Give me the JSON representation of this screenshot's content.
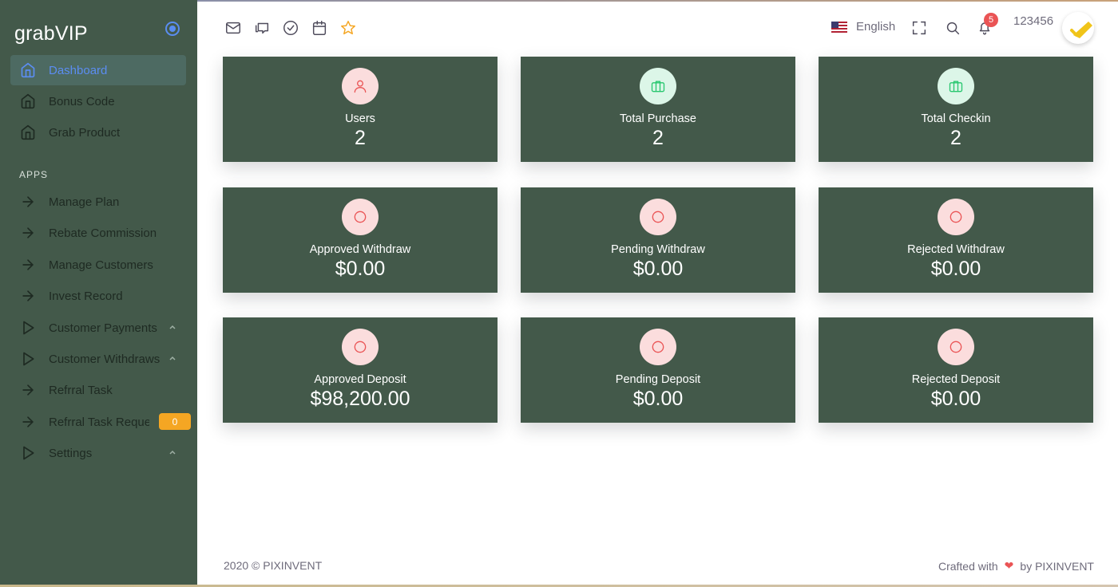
{
  "app": {
    "brand": "grabVIP"
  },
  "sidebar": {
    "items": [
      {
        "label": "Dashboard",
        "icon": "home-icon"
      },
      {
        "label": "Bonus Code",
        "icon": "home-icon"
      },
      {
        "label": "Grab Product",
        "icon": "home-icon"
      }
    ],
    "section_label": "APPS",
    "apps": [
      {
        "label": "Manage Plan",
        "icon": "arrow-right-icon"
      },
      {
        "label": "Rebate Commission",
        "icon": "arrow-right-icon"
      },
      {
        "label": "Manage Customers",
        "icon": "arrow-right-icon"
      },
      {
        "label": "Invest Record",
        "icon": "arrow-right-icon"
      },
      {
        "label": "Customer Payments",
        "icon": "play-icon"
      },
      {
        "label": "Customer Withdraws",
        "icon": "play-icon"
      },
      {
        "label": "Refrral Task",
        "icon": "arrow-right-icon"
      },
      {
        "label": "Refrral Task Request",
        "icon": "arrow-right-icon",
        "badge": "0"
      },
      {
        "label": "Settings",
        "icon": "play-icon"
      }
    ]
  },
  "topbar": {
    "language": "English",
    "notifications_count": "5",
    "username": "123456"
  },
  "cards": [
    {
      "title": "Users",
      "value": "2",
      "icon": "user-icon"
    },
    {
      "title": "Total Purchase",
      "value": "2",
      "icon": "briefcase-icon"
    },
    {
      "title": "Total Checkin",
      "value": "2",
      "icon": "briefcase-icon"
    },
    {
      "title": "Approved Withdraw",
      "value": "$0.00",
      "icon": "circle-icon"
    },
    {
      "title": "Pending Withdraw",
      "value": "$0.00",
      "icon": "circle-icon"
    },
    {
      "title": "Rejected Withdraw",
      "value": "$0.00",
      "icon": "circle-icon"
    },
    {
      "title": "Approved Deposit",
      "value": "$98,200.00",
      "icon": "circle-icon"
    },
    {
      "title": "Pending Deposit",
      "value": "$0.00",
      "icon": "circle-icon"
    },
    {
      "title": "Rejected Deposit",
      "value": "$0.00",
      "icon": "circle-icon"
    }
  ],
  "footer": {
    "copyright": "2020 © PIXINVENT",
    "crafted_prefix": "Crafted with",
    "crafted_suffix": "by PIXINVENT"
  },
  "colors": {
    "sidebar_bg": "#43594a",
    "card_bg": "#43594a",
    "accent": "#5b8df2",
    "badge": "#f5a623",
    "danger": "#ea5455"
  }
}
